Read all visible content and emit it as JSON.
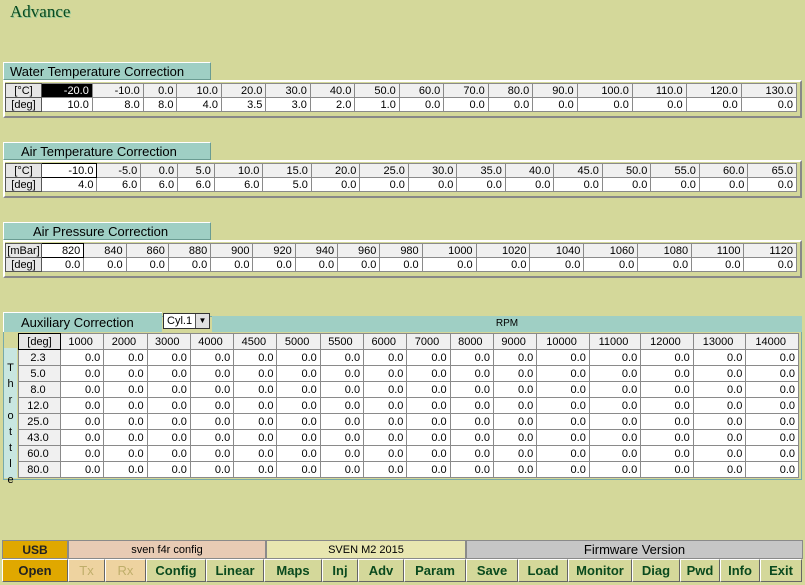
{
  "title": "Advance",
  "water": {
    "title": "Water Temperature Correction",
    "row1_label": "[°C]",
    "row2_label": "[deg]",
    "headers": [
      "-20.0",
      "-10.0",
      "0.0",
      "10.0",
      "20.0",
      "30.0",
      "40.0",
      "50.0",
      "60.0",
      "70.0",
      "80.0",
      "90.0",
      "100.0",
      "110.0",
      "120.0",
      "130.0"
    ],
    "values": [
      "10.0",
      "8.0",
      "8.0",
      "4.0",
      "3.5",
      "3.0",
      "2.0",
      "1.0",
      "0.0",
      "0.0",
      "0.0",
      "0.0",
      "0.0",
      "0.0",
      "0.0",
      "0.0"
    ]
  },
  "air_temp": {
    "title": "Air Temperature Correction",
    "row1_label": "[°C]",
    "row2_label": "[deg]",
    "headers": [
      "-10.0",
      "-5.0",
      "0.0",
      "5.0",
      "10.0",
      "15.0",
      "20.0",
      "25.0",
      "30.0",
      "35.0",
      "40.0",
      "45.0",
      "50.0",
      "55.0",
      "60.0",
      "65.0"
    ],
    "values": [
      "4.0",
      "6.0",
      "6.0",
      "6.0",
      "6.0",
      "5.0",
      "0.0",
      "0.0",
      "0.0",
      "0.0",
      "0.0",
      "0.0",
      "0.0",
      "0.0",
      "0.0",
      "0.0"
    ]
  },
  "air_pressure": {
    "title": "Air Pressure Correction",
    "row1_label": "[mBar]",
    "row2_label": "[deg]",
    "headers": [
      "820",
      "840",
      "860",
      "880",
      "900",
      "920",
      "940",
      "960",
      "980",
      "1000",
      "1020",
      "1040",
      "1060",
      "1080",
      "1100",
      "1120"
    ],
    "values": [
      "0.0",
      "0.0",
      "0.0",
      "0.0",
      "0.0",
      "0.0",
      "0.0",
      "0.0",
      "0.0",
      "0.0",
      "0.0",
      "0.0",
      "0.0",
      "0.0",
      "0.0",
      "0.0"
    ]
  },
  "aux": {
    "title": "Auxiliary Correction",
    "cylinder": "Cyl.1",
    "rpm_label": "RPM",
    "corner_label": "[deg]",
    "throttle_label": "Throttle",
    "rpm": [
      "1000",
      "2000",
      "3000",
      "4000",
      "4500",
      "5000",
      "5500",
      "6000",
      "7000",
      "8000",
      "9000",
      "10000",
      "11000",
      "12000",
      "13000",
      "14000"
    ],
    "rows": [
      {
        "throttle": "2.3",
        "values": [
          "0.0",
          "0.0",
          "0.0",
          "0.0",
          "0.0",
          "0.0",
          "0.0",
          "0.0",
          "0.0",
          "0.0",
          "0.0",
          "0.0",
          "0.0",
          "0.0",
          "0.0",
          "0.0"
        ]
      },
      {
        "throttle": "5.0",
        "values": [
          "0.0",
          "0.0",
          "0.0",
          "0.0",
          "0.0",
          "0.0",
          "0.0",
          "0.0",
          "0.0",
          "0.0",
          "0.0",
          "0.0",
          "0.0",
          "0.0",
          "0.0",
          "0.0"
        ]
      },
      {
        "throttle": "8.0",
        "values": [
          "0.0",
          "0.0",
          "0.0",
          "0.0",
          "0.0",
          "0.0",
          "0.0",
          "0.0",
          "0.0",
          "0.0",
          "0.0",
          "0.0",
          "0.0",
          "0.0",
          "0.0",
          "0.0"
        ]
      },
      {
        "throttle": "12.0",
        "values": [
          "0.0",
          "0.0",
          "0.0",
          "0.0",
          "0.0",
          "0.0",
          "0.0",
          "0.0",
          "0.0",
          "0.0",
          "0.0",
          "0.0",
          "0.0",
          "0.0",
          "0.0",
          "0.0"
        ]
      },
      {
        "throttle": "25.0",
        "values": [
          "0.0",
          "0.0",
          "0.0",
          "0.0",
          "0.0",
          "0.0",
          "0.0",
          "0.0",
          "0.0",
          "0.0",
          "0.0",
          "0.0",
          "0.0",
          "0.0",
          "0.0",
          "0.0"
        ]
      },
      {
        "throttle": "43.0",
        "values": [
          "0.0",
          "0.0",
          "0.0",
          "0.0",
          "0.0",
          "0.0",
          "0.0",
          "0.0",
          "0.0",
          "0.0",
          "0.0",
          "0.0",
          "0.0",
          "0.0",
          "0.0",
          "0.0"
        ]
      },
      {
        "throttle": "60.0",
        "values": [
          "0.0",
          "0.0",
          "0.0",
          "0.0",
          "0.0",
          "0.0",
          "0.0",
          "0.0",
          "0.0",
          "0.0",
          "0.0",
          "0.0",
          "0.0",
          "0.0",
          "0.0",
          "0.0"
        ]
      },
      {
        "throttle": "80.0",
        "values": [
          "0.0",
          "0.0",
          "0.0",
          "0.0",
          "0.0",
          "0.0",
          "0.0",
          "0.0",
          "0.0",
          "0.0",
          "0.0",
          "0.0",
          "0.0",
          "0.0",
          "0.0",
          "0.0"
        ]
      }
    ]
  },
  "footer": {
    "usb": "USB",
    "config_name": "sven f4r config",
    "ecu_name": "SVEN M2 2015",
    "firmware": "Firmware Version",
    "buttons": [
      "Open",
      "Tx",
      "Rx",
      "Config",
      "Linear",
      "Maps",
      "Inj",
      "Adv",
      "Param",
      "Save",
      "Load",
      "Monitor",
      "Diag",
      "Pwd",
      "Info",
      "Exit"
    ]
  },
  "colors": {
    "background": "#d4d89a",
    "section_bar": "#9fcfc4",
    "usb_orange": "#e0a800",
    "button_text": "#0a4a1e"
  }
}
